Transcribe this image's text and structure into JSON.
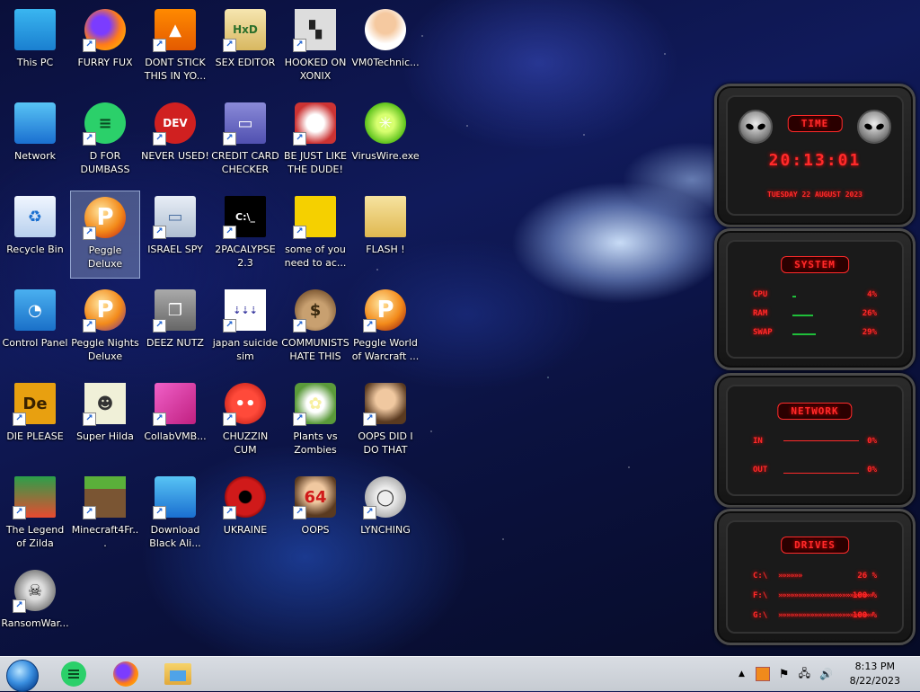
{
  "desktop": {
    "icons": [
      {
        "label": "This PC",
        "icon": "monitor-icon"
      },
      {
        "label": "FURRY FUX",
        "icon": "firefox-icon"
      },
      {
        "label": "DONT STICK THIS IN YO...",
        "icon": "vlc-cone-icon"
      },
      {
        "label": "SEX EDITOR",
        "icon": "hxd-icon"
      },
      {
        "label": "HOOKED ON XONIX",
        "icon": "xonix-icon"
      },
      {
        "label": "VM0Technic...",
        "icon": "doctor-icon"
      },
      {
        "label": "Network",
        "icon": "network-globe-icon"
      },
      {
        "label": "D FOR DUMBASS",
        "icon": "chat-bubble-icon"
      },
      {
        "label": "NEVER USED!",
        "icon": "dev-cpp-icon"
      },
      {
        "label": "CREDIT CARD CHECKER",
        "icon": "credit-card-icon"
      },
      {
        "label": "BE JUST LIKE THE DUDE!",
        "icon": "santa-icon"
      },
      {
        "label": "VirusWire.exe",
        "icon": "lime-icon"
      },
      {
        "label": "Recycle Bin",
        "icon": "recycle-bin-icon"
      },
      {
        "label": "Peggle Deluxe",
        "icon": "peggle-icon"
      },
      {
        "label": "ISRAEL SPY",
        "icon": "spy-device-icon"
      },
      {
        "label": "2PACALYPSE 2.3",
        "icon": "terminal-icon"
      },
      {
        "label": "some of you need to ac...",
        "icon": "beaver-icon"
      },
      {
        "label": "FLASH !",
        "icon": "folder-icon"
      },
      {
        "label": "Control Panel",
        "icon": "control-panel-icon"
      },
      {
        "label": "Peggle Nights Deluxe",
        "icon": "peggle-nights-icon"
      },
      {
        "label": "DEEZ NUTZ",
        "icon": "stacked-windows-icon"
      },
      {
        "label": "japan suicide sim",
        "icon": "document-icon"
      },
      {
        "label": "COMMUNISTS HATE THIS G...",
        "icon": "money-bag-icon"
      },
      {
        "label": "Peggle World of Warcraft ...",
        "icon": "peggle-wow-icon"
      },
      {
        "label": "DIE PLEASE",
        "icon": "de-icon"
      },
      {
        "label": "Super Hilda",
        "icon": "pixel-character-icon"
      },
      {
        "label": "CollabVMB...",
        "icon": "monitor-pink-icon"
      },
      {
        "label": "CHUZZIN CUM",
        "icon": "chuzzle-icon"
      },
      {
        "label": "Plants vs Zombies",
        "icon": "flower-icon"
      },
      {
        "label": "OOPS DID I DO THAT",
        "icon": "portrait-icon"
      },
      {
        "label": "The Legend of Zilda",
        "icon": "pixel-hero-icon"
      },
      {
        "label": "Minecraft4Fr...",
        "icon": "grass-block-icon"
      },
      {
        "label": "Download Black Ali...",
        "icon": "network-globe-icon"
      },
      {
        "label": "UKRAINE",
        "icon": "radiation-icon"
      },
      {
        "label": "OOPS",
        "icon": "portrait-64-icon"
      },
      {
        "label": "LYNCHING",
        "icon": "noose-icon"
      },
      {
        "label": "RansomWar...",
        "icon": "skull-icon"
      }
    ]
  },
  "gadget": {
    "time": {
      "title": "TIME",
      "clock": "20:13:01",
      "date": "TUESDAY 22 AUGUST 2023"
    },
    "system": {
      "title": "SYSTEM",
      "rows": [
        {
          "label": "CPU",
          "value": "4%",
          "level": 0.04
        },
        {
          "label": "RAM",
          "value": "26%",
          "level": 0.26
        },
        {
          "label": "SWAP",
          "value": "29%",
          "level": 0.29
        }
      ]
    },
    "network": {
      "title": "NETWORK",
      "rows": [
        {
          "label": "IN",
          "value": "0%"
        },
        {
          "label": "OUT",
          "value": "0%"
        }
      ]
    },
    "drives": {
      "title": "DRIVES",
      "rows": [
        {
          "label": "C:\\",
          "value": "26 %",
          "level": 0.26
        },
        {
          "label": "F:\\",
          "value": "100 %",
          "level": 1.0
        },
        {
          "label": "G:\\",
          "value": "100 %",
          "level": 1.0
        }
      ]
    }
  },
  "taskbar": {
    "pinned": [
      "start-orb",
      "chat-app-icon",
      "firefox-icon",
      "file-explorer-icon"
    ],
    "clock_time": "8:13 PM",
    "clock_date": "8/22/2023"
  },
  "colors": {
    "gadget_red": "#ff2a2a",
    "taskbar": "#d0d4da"
  }
}
